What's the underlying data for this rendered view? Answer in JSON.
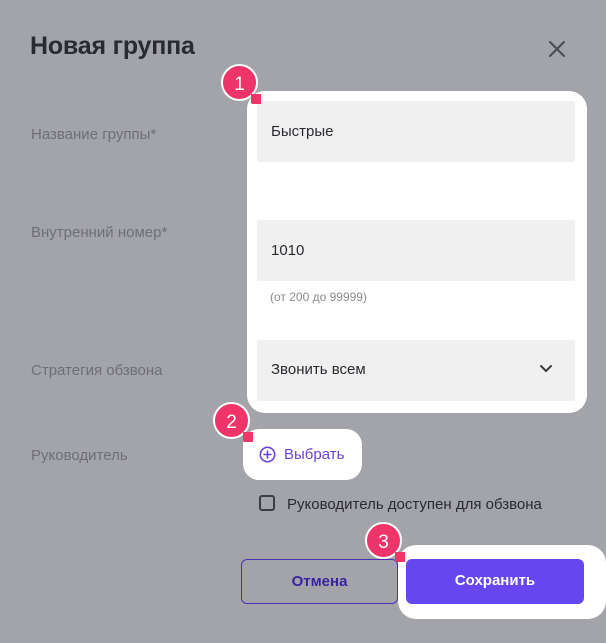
{
  "dialog": {
    "title": "Новая группа"
  },
  "form": {
    "group_name_label": "Название группы*",
    "group_name_value": "Быстрые",
    "extension_label": "Внутренний номер*",
    "extension_value": "1010",
    "extension_hint": "(от 200 до 99999)",
    "strategy_label": "Стратегия обзвона",
    "strategy_value": "Звонить всем",
    "manager_label": "Руководитель",
    "choose_label": "Выбрать",
    "manager_available_label": "Руководитель доступен для обзвона",
    "manager_available_checked": false
  },
  "buttons": {
    "cancel_label": "Отмена",
    "save_label": "Сохранить"
  },
  "markers": [
    "1",
    "2",
    "3"
  ],
  "colors": {
    "accent": "#6447ef",
    "marker": "#ee3468",
    "overlay": "#a3a4a9"
  },
  "icons": [
    "close-icon",
    "chevron-down-icon",
    "plus-circle-icon",
    "checkbox-icon"
  ]
}
